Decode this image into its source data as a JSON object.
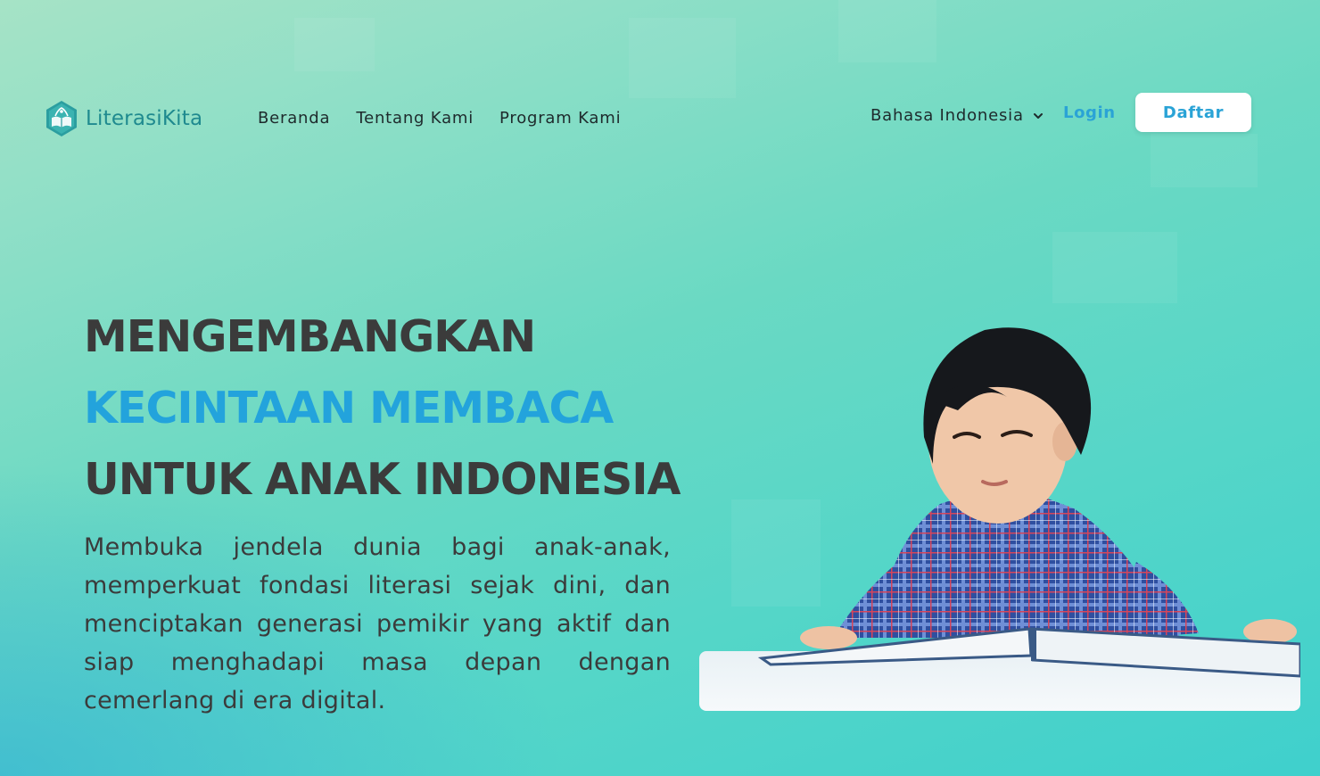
{
  "brand": {
    "name": "LiterasiKita"
  },
  "nav": {
    "items": [
      {
        "label": "Beranda"
      },
      {
        "label": "Tentang Kami"
      },
      {
        "label": "Program Kami"
      }
    ]
  },
  "header": {
    "language": "Bahasa Indonesia",
    "login_label": "Login",
    "register_label": "Daftar"
  },
  "hero": {
    "title_line1": "MENGEMBANGKAN",
    "title_line2": "KECINTAAN MEMBACA",
    "title_line3": "UNTUK ANAK INDONESIA",
    "description": "Membuka jendela dunia bagi anak-anak, memperkuat fondasi literasi sejak dini, dan menciptakan generasi pemikir yang aktif dan siap menghadapi masa depan dengan cemerlang di era digital."
  },
  "colors": {
    "accent": "#23a3dc",
    "brand": "#1f8a8f",
    "heading": "#3b3b3b"
  },
  "icons": {
    "logo": "book-hexagon-logo-icon",
    "language_dropdown": "chevron-down-icon"
  }
}
